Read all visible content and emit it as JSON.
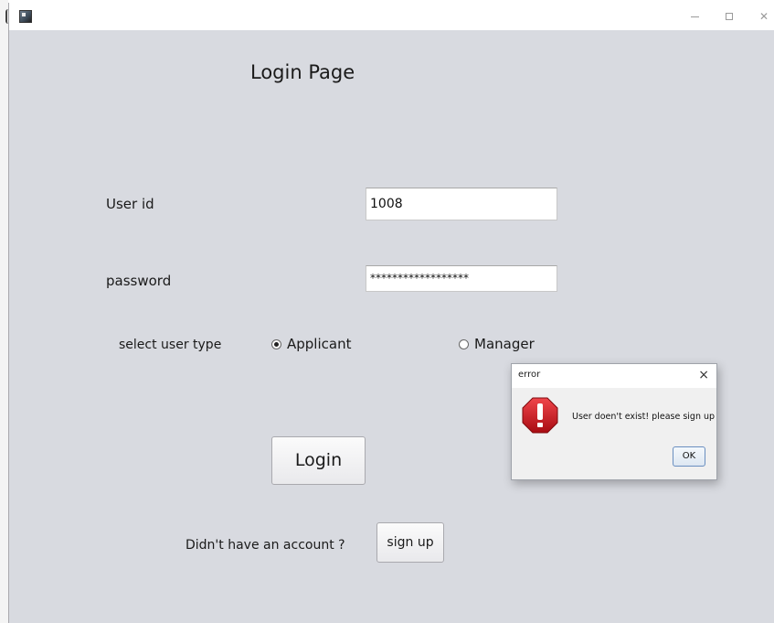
{
  "window": {
    "icons": {
      "app": "java-app-icon",
      "minimize": "minimize-icon",
      "maximize": "maximize-icon",
      "close": "close-icon"
    }
  },
  "form": {
    "title": "Login Page",
    "user_id_label": "User id",
    "user_id_value": "1008",
    "password_label": "password",
    "password_value": "******************",
    "user_type_label": "select user type",
    "user_types": [
      {
        "label": "Applicant",
        "selected": true
      },
      {
        "label": "Manager",
        "selected": false
      }
    ],
    "login_button": "Login",
    "no_account_text": "Didn't have an account ?",
    "signup_button": "sign up"
  },
  "dialog": {
    "title": "error",
    "close_symbol": "×",
    "icon": "error-icon",
    "message": "User doen't exist! please sign up",
    "ok_button": "OK"
  },
  "colors": {
    "window_bg": "#d8dae0",
    "dialog_bg": "#f0f0f0",
    "error_red": "#d0161e",
    "ok_border": "#6a8fc0"
  }
}
